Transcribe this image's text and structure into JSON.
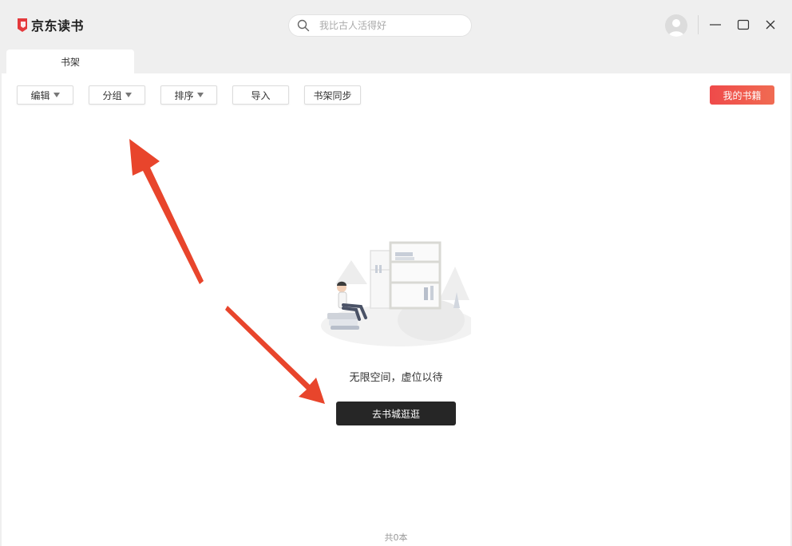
{
  "app": {
    "title": "京东读书"
  },
  "search": {
    "placeholder": "我比古人活得好"
  },
  "tabs": [
    {
      "label": "书架"
    }
  ],
  "toolbar": {
    "edit_label": "编辑",
    "group_label": "分组",
    "sort_label": "排序",
    "import_label": "导入",
    "sync_label": "书架同步",
    "my_books_label": "我的书籍"
  },
  "empty_state": {
    "message": "无限空间，虚位以待",
    "button_label": "去书城逛逛"
  },
  "footer": {
    "count_text": "共0本"
  },
  "colors": {
    "brand_red": "#e4393c",
    "accent_gradient_start": "#ef4a4a",
    "accent_gradient_end": "#f06b52",
    "annotation_arrow": "#e8452c",
    "primary_button": "#262626"
  },
  "icons": [
    "jd-read-logo-icon",
    "search-icon",
    "avatar-icon",
    "minimize-icon",
    "maximize-icon",
    "close-icon",
    "dropdown-caret-icon",
    "empty-bookshelf-illustration"
  ]
}
